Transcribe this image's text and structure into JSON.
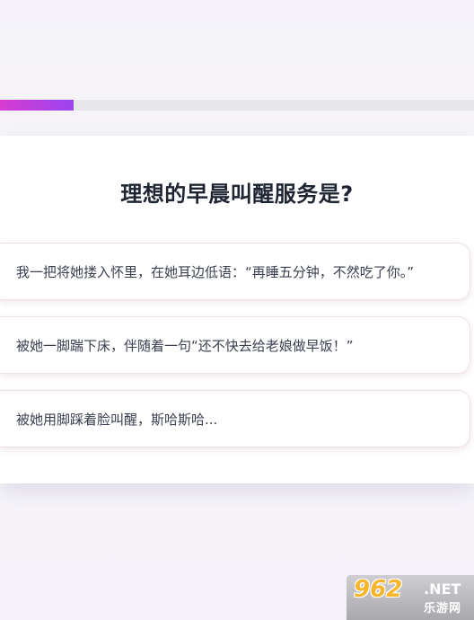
{
  "progress": {
    "value": 0.155,
    "fill_color": "#9b44f0",
    "track_color": "#e7e7ea"
  },
  "question": {
    "title": "理想的早晨叫醒服务是?"
  },
  "options": [
    {
      "label": "我一把将她搂入怀里，在她耳边低语：“再睡五分钟，不然吃了你。”"
    },
    {
      "label": "被她一脚踹下床，伴随着一句“还不快去给老娘做早饭！”"
    },
    {
      "label": "被她用脚踩着脸叫醒，斯哈斯哈..."
    }
  ],
  "watermark": {
    "brand": "962",
    "suffix": ".NET",
    "tagline": "乐游网"
  }
}
